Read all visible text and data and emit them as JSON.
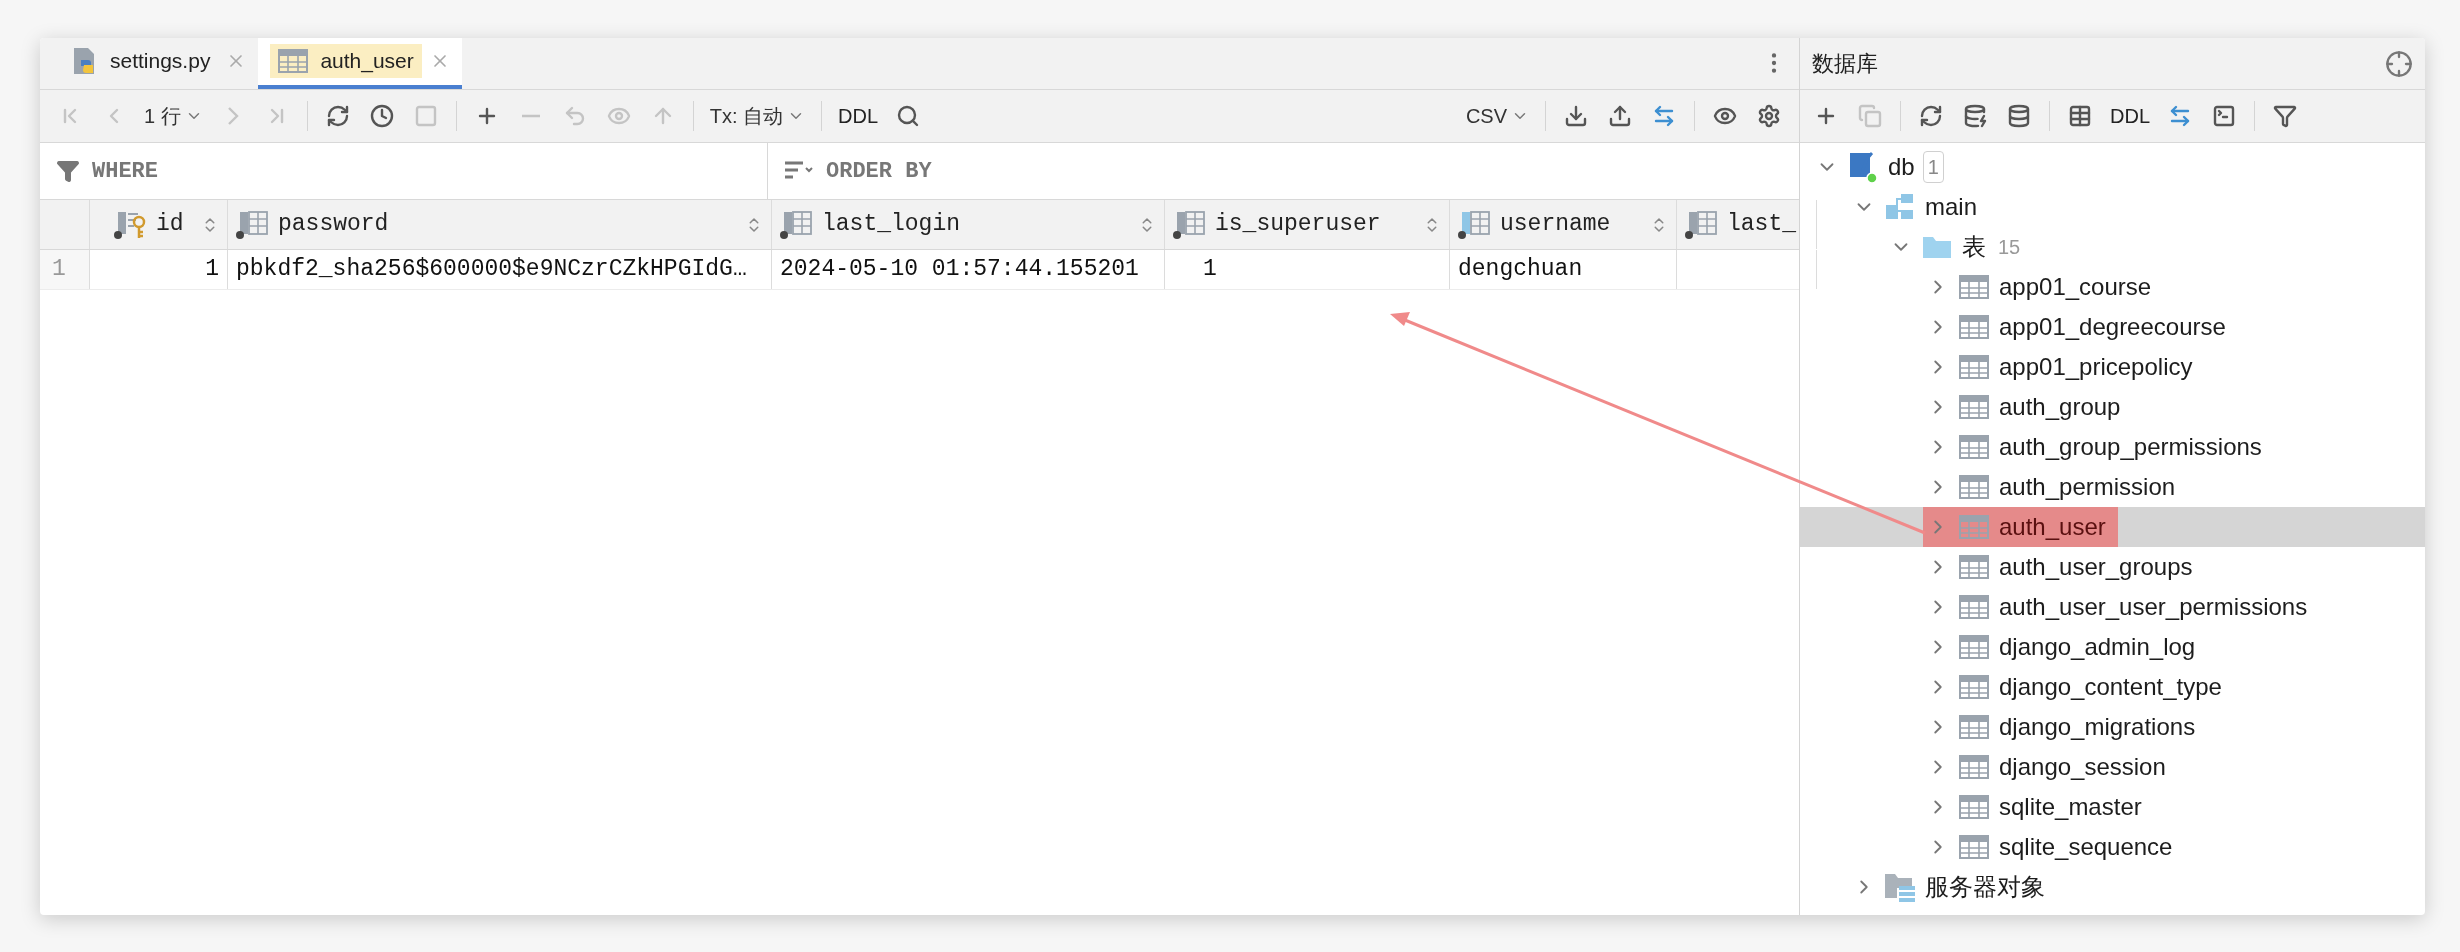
{
  "tabs": [
    {
      "label": "settings.py",
      "kind": "python",
      "selected": false
    },
    {
      "label": "auth_user",
      "kind": "table",
      "selected": true
    }
  ],
  "toolbar": {
    "items": [
      {
        "kind": "icon",
        "disabled": true
      },
      {
        "kind": "icon",
        "disabled": true
      },
      {
        "kind": "dropdown",
        "label": "1 行"
      },
      {
        "kind": "icon",
        "disabled": true
      },
      {
        "kind": "icon",
        "disabled": true
      },
      {
        "kind": "separator"
      },
      {
        "kind": "icon",
        "disabled": false
      },
      {
        "kind": "icon",
        "disabled": false
      },
      {
        "kind": "icon",
        "disabled": true
      },
      {
        "kind": "separator"
      },
      {
        "kind": "icon",
        "disabled": false
      },
      {
        "kind": "icon",
        "disabled": true
      },
      {
        "kind": "icon",
        "disabled": true
      },
      {
        "kind": "icon",
        "disabled": true
      },
      {
        "kind": "icon",
        "disabled": true
      },
      {
        "kind": "separator"
      },
      {
        "kind": "dropdown",
        "label": "Tx: 自动"
      },
      {
        "kind": "separator"
      },
      {
        "kind": "text",
        "label": "DDL"
      },
      {
        "kind": "icon",
        "disabled": false
      },
      {
        "kind": "spacer"
      },
      {
        "kind": "dropdown",
        "label": "CSV"
      },
      {
        "kind": "separator"
      },
      {
        "kind": "icon",
        "disabled": false
      },
      {
        "kind": "icon",
        "disabled": false
      },
      {
        "kind": "icon",
        "disabled": false
      },
      {
        "kind": "separator"
      },
      {
        "kind": "icon",
        "disabled": false
      },
      {
        "kind": "icon",
        "disabled": false
      }
    ]
  },
  "filters": {
    "where": "WHERE",
    "order_by": "ORDER BY"
  },
  "table": {
    "columns": [
      {
        "name": "id",
        "kind": "primary_key"
      },
      {
        "name": "password",
        "kind": "column"
      },
      {
        "name": "last_login",
        "kind": "column"
      },
      {
        "name": "is_superuser",
        "kind": "column"
      },
      {
        "name": "username",
        "kind": "indexed"
      },
      {
        "name": "last_",
        "kind": "column"
      }
    ],
    "rows": [
      {
        "number": "1",
        "cells": [
          "1",
          "pbkdf2_sha256$600000$e9NCzrCZkHPGIdG…",
          "2024-05-10 01:57:44.155201",
          "1",
          "dengchuan",
          ""
        ]
      }
    ]
  },
  "database_panel": {
    "title": "数据库",
    "toolbar": {
      "items": [
        {
          "kind": "icon",
          "disabled": false
        },
        {
          "kind": "icon",
          "disabled": true
        },
        {
          "kind": "separator"
        },
        {
          "kind": "icon",
          "disabled": false
        },
        {
          "kind": "icon",
          "disabled": false
        },
        {
          "kind": "icon",
          "disabled": false
        },
        {
          "kind": "separator"
        },
        {
          "kind": "icon",
          "disabled": false
        },
        {
          "kind": "text",
          "label": "DDL"
        },
        {
          "kind": "icon",
          "disabled": false
        },
        {
          "kind": "icon",
          "disabled": false
        },
        {
          "kind": "separator"
        },
        {
          "kind": "icon",
          "disabled": false
        }
      ]
    },
    "tree": [
      {
        "label": "db",
        "kind": "database",
        "count": "1",
        "expanded": true,
        "selected": false,
        "annotated": false,
        "children": [
          {
            "label": "main",
            "kind": "schema",
            "expanded": true,
            "selected": false,
            "annotated": false,
            "children": [
              {
                "label": "表",
                "kind": "folder",
                "count": "15",
                "expanded": true,
                "selected": false,
                "annotated": false,
                "children": [
                  {
                    "label": "app01_course",
                    "kind": "table",
                    "expanded": false,
                    "selected": false,
                    "annotated": false
                  },
                  {
                    "label": "app01_degreecourse",
                    "kind": "table",
                    "expanded": false,
                    "selected": false,
                    "annotated": false
                  },
                  {
                    "label": "app01_pricepolicy",
                    "kind": "table",
                    "expanded": false,
                    "selected": false,
                    "annotated": false
                  },
                  {
                    "label": "auth_group",
                    "kind": "table",
                    "expanded": false,
                    "selected": false,
                    "annotated": false
                  },
                  {
                    "label": "auth_group_permissions",
                    "kind": "table",
                    "expanded": false,
                    "selected": false,
                    "annotated": false
                  },
                  {
                    "label": "auth_permission",
                    "kind": "table",
                    "expanded": false,
                    "selected": false,
                    "annotated": false
                  },
                  {
                    "label": "auth_user",
                    "kind": "table",
                    "expanded": false,
                    "selected": true,
                    "annotated": true
                  },
                  {
                    "label": "auth_user_groups",
                    "kind": "table",
                    "expanded": false,
                    "selected": false,
                    "annotated": false
                  },
                  {
                    "label": "auth_user_user_permissions",
                    "kind": "table",
                    "expanded": false,
                    "selected": false,
                    "annotated": false
                  },
                  {
                    "label": "django_admin_log",
                    "kind": "table",
                    "expanded": false,
                    "selected": false,
                    "annotated": false
                  },
                  {
                    "label": "django_content_type",
                    "kind": "table",
                    "expanded": false,
                    "selected": false,
                    "annotated": false
                  },
                  {
                    "label": "django_migrations",
                    "kind": "table",
                    "expanded": false,
                    "selected": false,
                    "annotated": false
                  },
                  {
                    "label": "django_session",
                    "kind": "table",
                    "expanded": false,
                    "selected": false,
                    "annotated": false
                  },
                  {
                    "label": "sqlite_master",
                    "kind": "table",
                    "expanded": false,
                    "selected": false,
                    "annotated": false
                  },
                  {
                    "label": "sqlite_sequence",
                    "kind": "table",
                    "expanded": false,
                    "selected": false,
                    "annotated": false
                  }
                ]
              }
            ]
          },
          {
            "label": "服务器对象",
            "kind": "server_objects",
            "expanded": false,
            "selected": false,
            "annotated": false
          }
        ]
      }
    ]
  }
}
